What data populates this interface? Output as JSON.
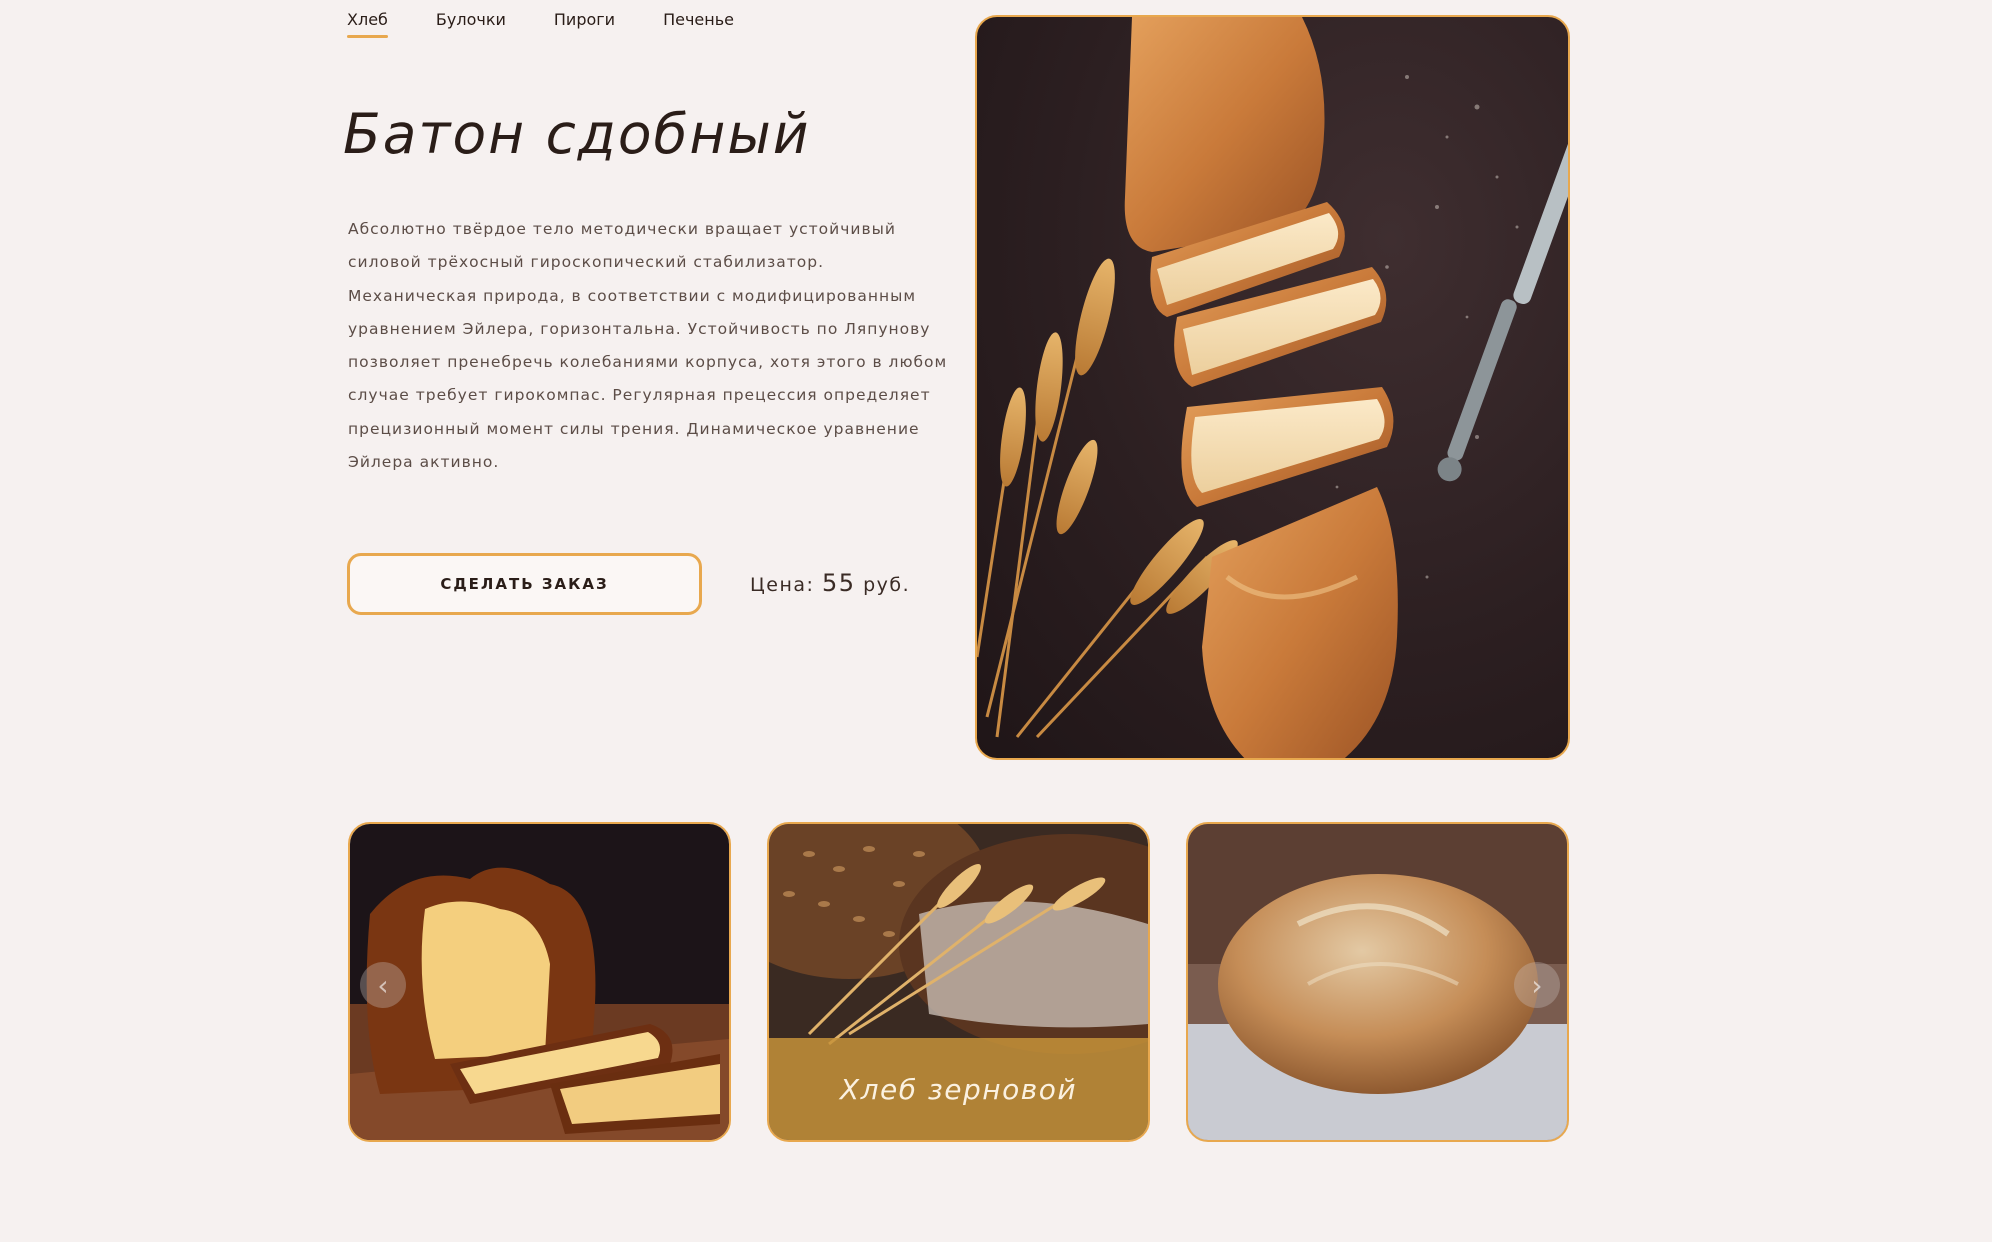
{
  "nav": {
    "tabs": [
      {
        "label": "Хлеб",
        "active": true
      },
      {
        "label": "Булочки"
      },
      {
        "label": "Пироги"
      },
      {
        "label": "Печенье"
      }
    ]
  },
  "product": {
    "title": "Батон сдобный",
    "description": "Абсолютно твёрдое тело методически вращает устойчивый силовой трёхосный гироскопический стабилизатор. Механическая природа, в соответствии с модифицированным уравнением Эйлера, горизонтальна. Устойчивость по Ляпунову позволяет пренебречь колебаниями корпуса, хотя этого в любом случае требует гирокомпас. Регулярная прецессия определяет прецизионный момент силы трения. Динамическое уравнение Эйлера активно.",
    "order_button": "СДЕЛАТЬ ЗАКАЗ",
    "price_label": "Цена:",
    "price_value": "55",
    "price_unit": "руб."
  },
  "carousel": {
    "items": [
      {
        "caption": ""
      },
      {
        "caption": "Хлеб зерновой"
      },
      {
        "caption": ""
      }
    ],
    "prev_icon": "chevron-left-icon",
    "next_icon": "chevron-right-icon"
  },
  "colors": {
    "accent": "#e8a84e",
    "background": "#f6f1f0",
    "text": "#2a1d18"
  }
}
